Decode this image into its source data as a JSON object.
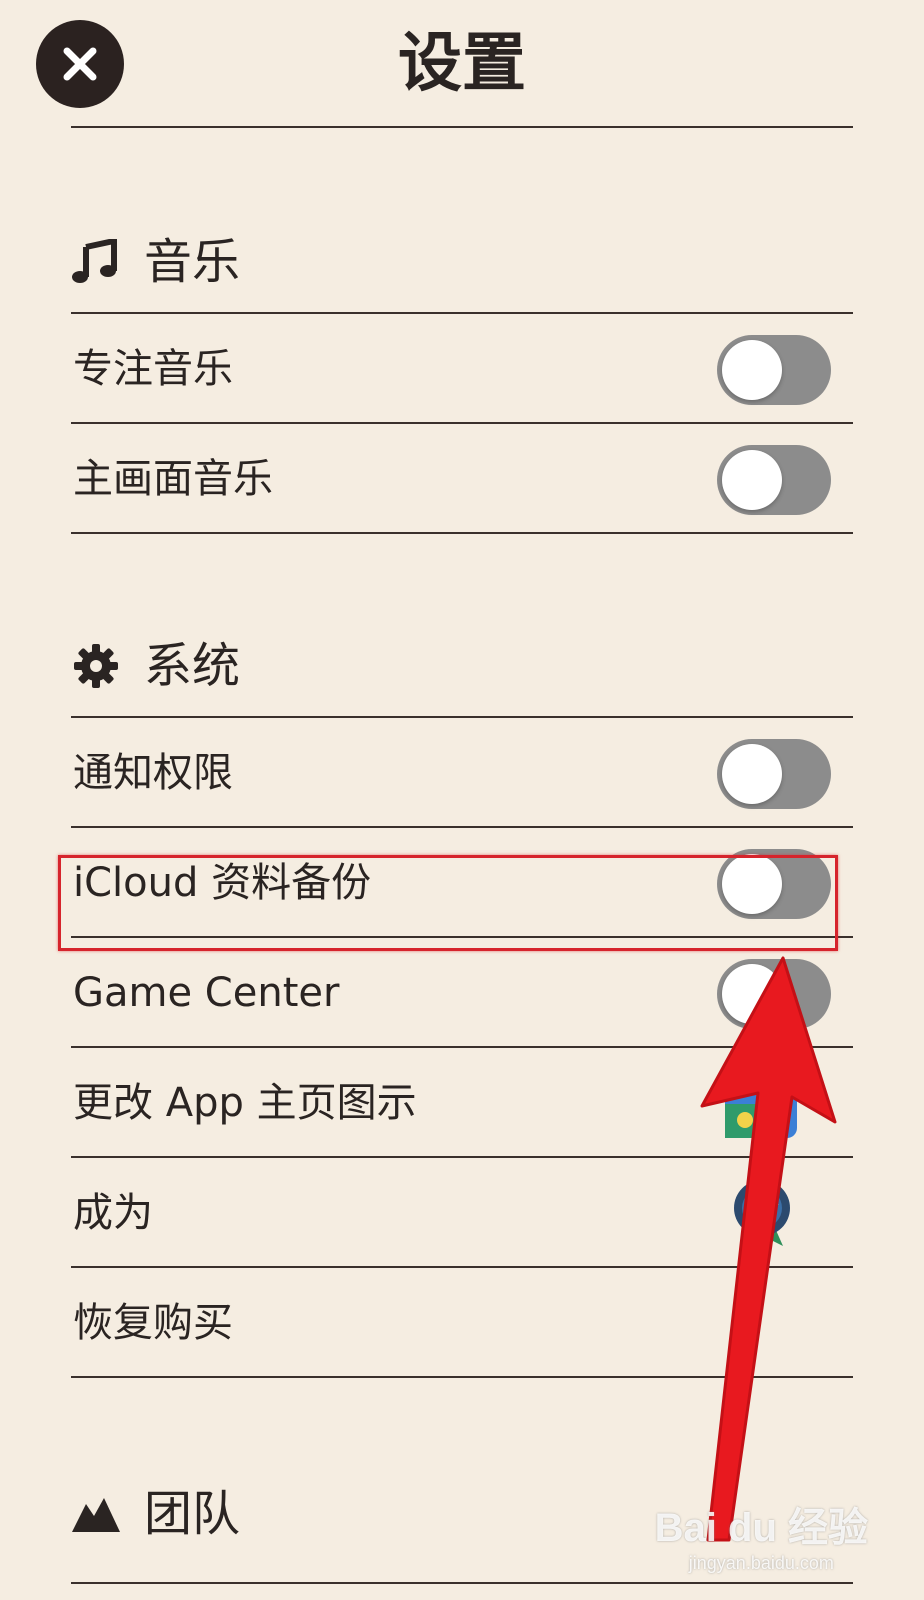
{
  "header": {
    "title": "设置",
    "close_icon": "close-icon"
  },
  "sections": {
    "music": {
      "icon": "music-note-icon",
      "title": "音乐",
      "rows": [
        {
          "label": "专注音乐",
          "toggle_on": false
        },
        {
          "label": "主画面音乐",
          "toggle_on": false
        }
      ]
    },
    "system": {
      "icon": "gear-icon",
      "title": "系统",
      "rows": [
        {
          "label": "通知权限",
          "toggle_on": false
        },
        {
          "label": "iCloud 资料备份",
          "toggle_on": false
        },
        {
          "label": "Game Center",
          "toggle_on": false
        },
        {
          "label": "更改 App 主页图示",
          "accessory": "app-icon-thumbnail"
        },
        {
          "label": "成为",
          "accessory": "badge-icon"
        },
        {
          "label": "恢复购买"
        }
      ]
    },
    "team": {
      "icon": "mountain-icon",
      "title": "团队"
    }
  },
  "colors": {
    "background": "#f5ede1",
    "text": "#2a2422",
    "toggle_off": "#8c8c8c",
    "annotation": "#e8191f"
  },
  "watermark": {
    "main": "Bai du 经验",
    "sub": "jingyan.baidu.com"
  }
}
